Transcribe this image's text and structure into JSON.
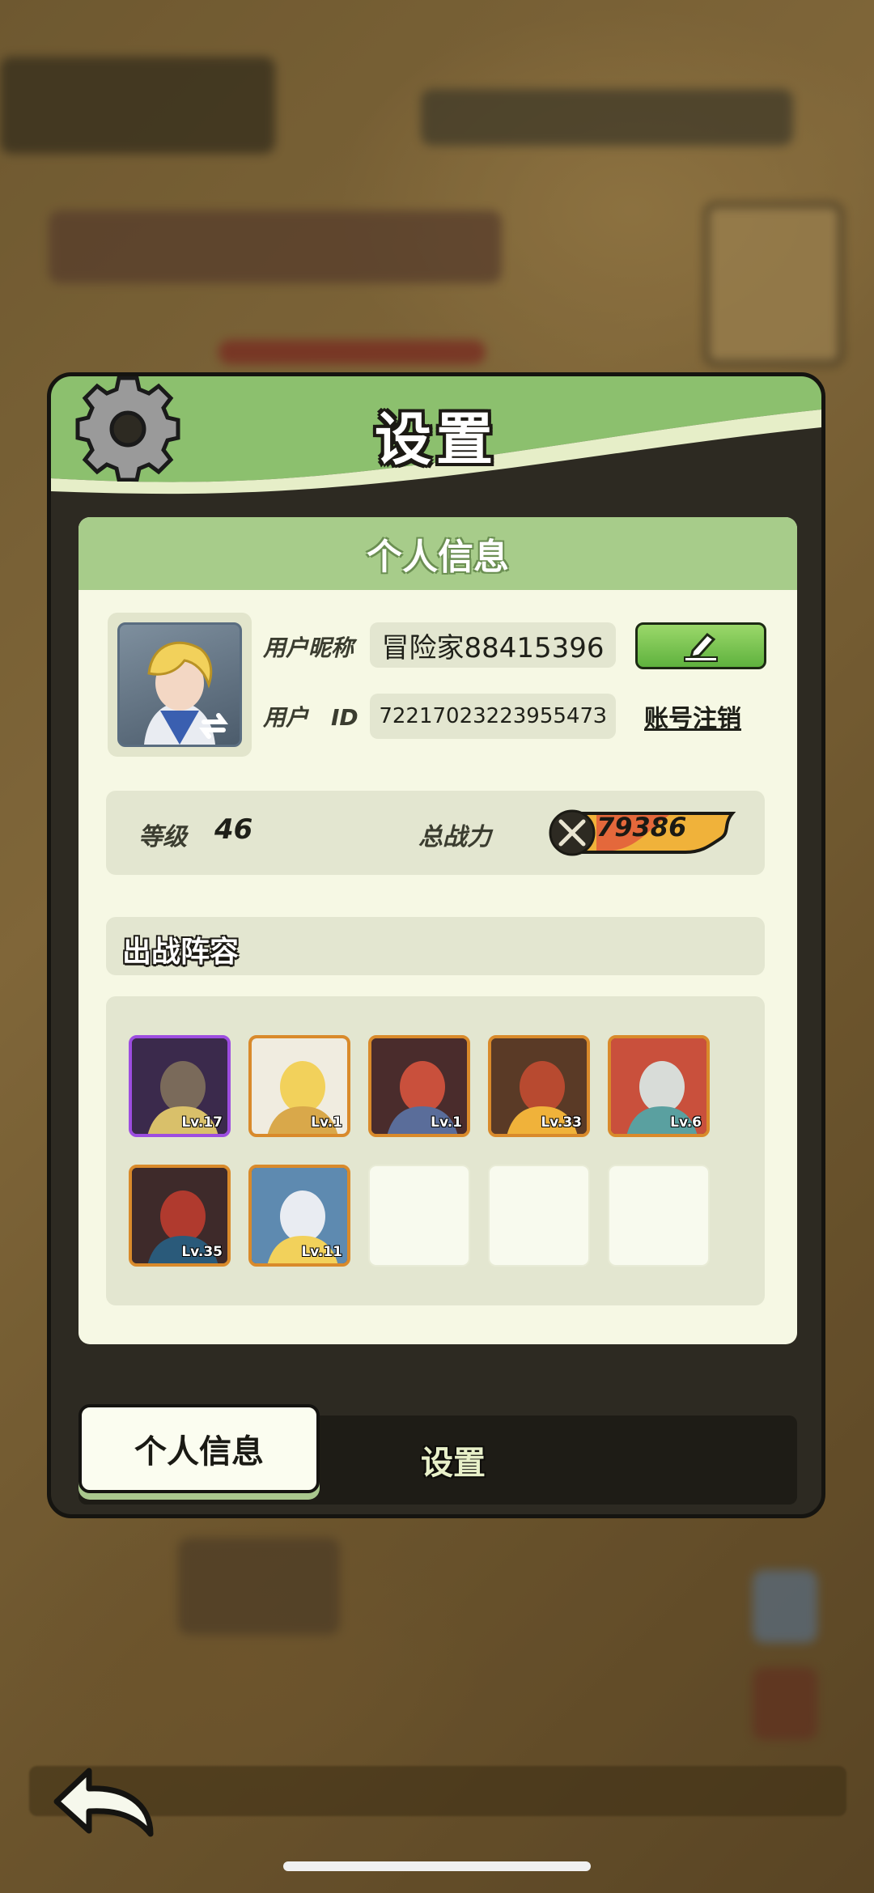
{
  "panel": {
    "title": "设置"
  },
  "profile": {
    "section_title": "个人信息",
    "nickname_label": "用户昵称",
    "nickname_value": "冒险家88415396",
    "id_label": "用户　ID",
    "id_value": "7221702322395547З",
    "logout_label": "账号注销"
  },
  "stats": {
    "level_label": "等级",
    "level_value": "46",
    "power_label": "总战力",
    "power_value": "79386"
  },
  "team": {
    "title": "出战阵容",
    "heroes": [
      {
        "level": "Lv.17",
        "rarity": "purple"
      },
      {
        "level": "Lv.1",
        "rarity": "orange"
      },
      {
        "level": "Lv.1",
        "rarity": "orange"
      },
      {
        "level": "Lv.33",
        "rarity": "orange"
      },
      {
        "level": "Lv.6",
        "rarity": "orange"
      },
      {
        "level": "Lv.35",
        "rarity": "orange"
      },
      {
        "level": "Lv.11",
        "rarity": "orange"
      }
    ],
    "empty_slots": 3
  },
  "tabs": {
    "active": "个人信息",
    "inactive": "设置"
  },
  "icons": [
    "gear-icon",
    "edit-pencil-icon",
    "swap-icon",
    "crossed-swords-icon",
    "back-arrow-icon"
  ],
  "colors": {
    "accent_green": "#a7cc8a",
    "panel_dark": "#2d2a22",
    "content_bg": "#f6f8e4",
    "power_orange": "#f0b23a"
  }
}
